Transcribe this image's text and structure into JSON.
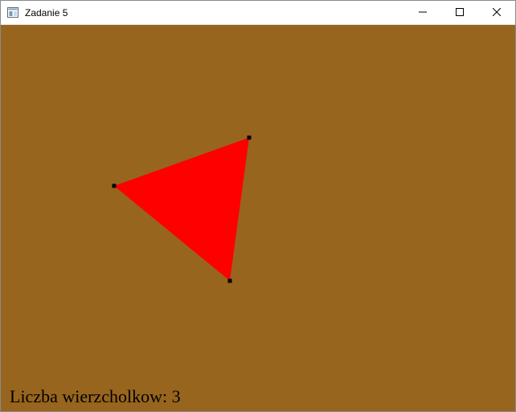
{
  "window": {
    "title": "Zadanie 5"
  },
  "colors": {
    "background": "#98651e",
    "shape_fill": "#ff0000",
    "vertex_marker": "#000000"
  },
  "icons": {
    "app": "window-app-icon",
    "minimize": "minimize-icon",
    "maximize": "maximize-icon",
    "close": "close-icon"
  },
  "status": {
    "vertex_count_text": "Liczba wierzcholkow: 3"
  }
}
